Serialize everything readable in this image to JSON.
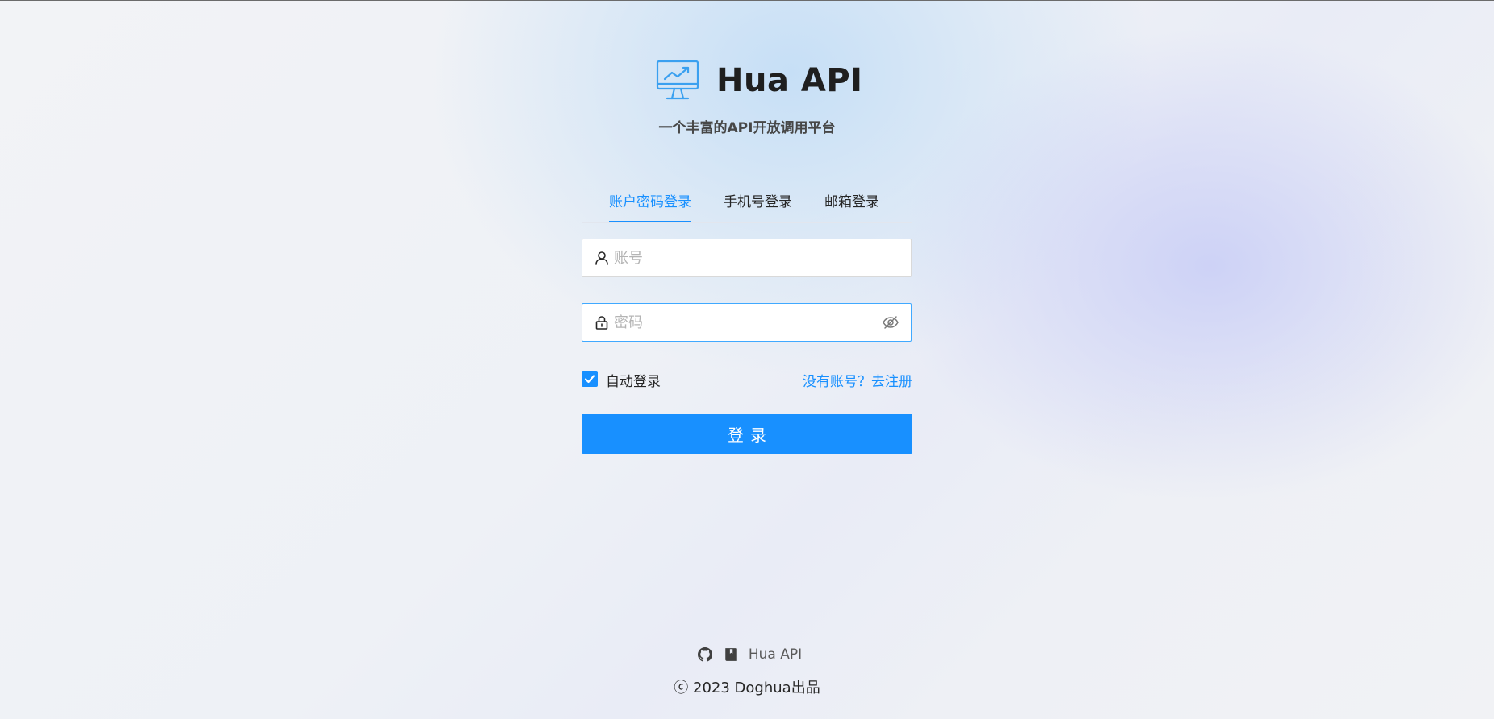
{
  "app": {
    "title": "Hua API",
    "subtitle": "一个丰富的API开放调用平台",
    "logo_icon": "monitor-chart-icon"
  },
  "tabs": [
    {
      "label": "账户密码登录",
      "active": true
    },
    {
      "label": "手机号登录",
      "active": false
    },
    {
      "label": "邮箱登录",
      "active": false
    }
  ],
  "form": {
    "username": {
      "placeholder": "账号",
      "value": "",
      "icon": "user-icon"
    },
    "password": {
      "placeholder": "密码",
      "value": "",
      "icon": "lock-icon",
      "toggle_icon": "eye-invisible-icon"
    },
    "auto_login": {
      "label": "自动登录",
      "checked": true
    },
    "register_link": "没有账号？去注册",
    "submit_label": "登录"
  },
  "footer": {
    "icons": [
      "github-icon",
      "book-icon"
    ],
    "link_text": "Hua API",
    "copyright": "ⓒ 2023 Doghua出品"
  },
  "colors": {
    "primary": "#1890ff",
    "text": "#262626",
    "placeholder": "#b4b4b4"
  }
}
